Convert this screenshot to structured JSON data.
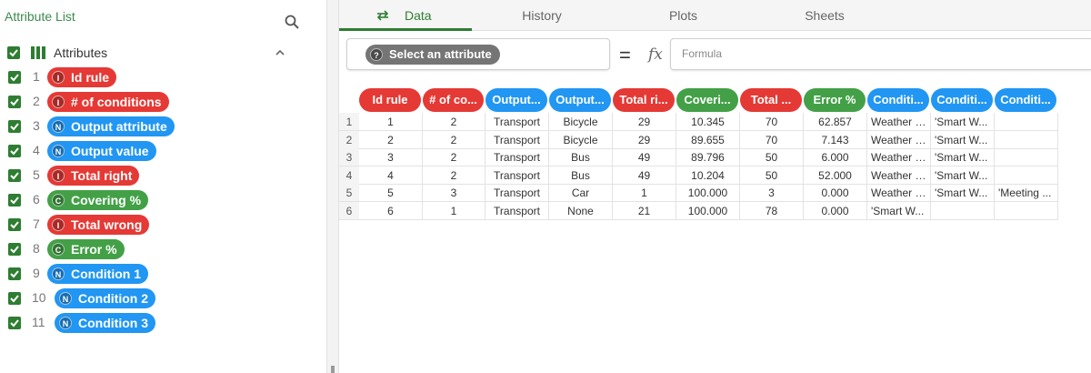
{
  "left_panel": {
    "title": "Attribute List",
    "header_label": "Attributes",
    "attributes": [
      {
        "index": "1",
        "name": "Id rule",
        "type": "I",
        "color": "#e53935"
      },
      {
        "index": "2",
        "name": "# of conditions",
        "type": "I",
        "color": "#e53935"
      },
      {
        "index": "3",
        "name": "Output attribute",
        "type": "N",
        "color": "#2196f3"
      },
      {
        "index": "4",
        "name": "Output value",
        "type": "N",
        "color": "#2196f3"
      },
      {
        "index": "5",
        "name": "Total right",
        "type": "I",
        "color": "#e53935"
      },
      {
        "index": "6",
        "name": "Covering %",
        "type": "C",
        "color": "#43a047"
      },
      {
        "index": "7",
        "name": "Total wrong",
        "type": "I",
        "color": "#e53935"
      },
      {
        "index": "8",
        "name": "Error %",
        "type": "C",
        "color": "#43a047"
      },
      {
        "index": "9",
        "name": "Condition 1",
        "type": "N",
        "color": "#2196f3"
      },
      {
        "index": "10",
        "name": "Condition 2",
        "type": "N",
        "color": "#2196f3"
      },
      {
        "index": "11",
        "name": "Condition 3",
        "type": "N",
        "color": "#2196f3"
      }
    ]
  },
  "tabs": [
    "Data",
    "History",
    "Plots",
    "Sheets"
  ],
  "formula_bar": {
    "select_badge": "?",
    "select_label": "Select an attribute",
    "equals": "=",
    "fx": "fx",
    "formula_placeholder": "Formula"
  },
  "table": {
    "headers": [
      {
        "label": "Id rule",
        "type": "I"
      },
      {
        "label": "# of co...",
        "type": "I"
      },
      {
        "label": "Output...",
        "type": "N"
      },
      {
        "label": "Output...",
        "type": "N"
      },
      {
        "label": "Total ri...",
        "type": "I"
      },
      {
        "label": "Coveri...",
        "type": "C"
      },
      {
        "label": "Total ...",
        "type": "I"
      },
      {
        "label": "Error %",
        "type": "C"
      },
      {
        "label": "Conditi...",
        "type": "N"
      },
      {
        "label": "Conditi...",
        "type": "N"
      },
      {
        "label": "Conditi...",
        "type": "N"
      }
    ],
    "rows": [
      {
        "n": "1",
        "cells": [
          "1",
          "2",
          "Transport",
          "Bicycle",
          "29",
          "10.345",
          "70",
          "62.857",
          "Weather i...",
          "'Smart W...",
          ""
        ]
      },
      {
        "n": "2",
        "cells": [
          "2",
          "2",
          "Transport",
          "Bicycle",
          "29",
          "89.655",
          "70",
          "7.143",
          "Weather i...",
          "'Smart W...",
          ""
        ]
      },
      {
        "n": "3",
        "cells": [
          "3",
          "2",
          "Transport",
          "Bus",
          "49",
          "89.796",
          "50",
          "6.000",
          "Weather i...",
          "'Smart W...",
          ""
        ]
      },
      {
        "n": "4",
        "cells": [
          "4",
          "2",
          "Transport",
          "Bus",
          "49",
          "10.204",
          "50",
          "52.000",
          "Weather i...",
          "'Smart W...",
          ""
        ]
      },
      {
        "n": "5",
        "cells": [
          "5",
          "3",
          "Transport",
          "Car",
          "1",
          "100.000",
          "3",
          "0.000",
          "Weather i...",
          "'Smart W...",
          "'Meeting ..."
        ]
      },
      {
        "n": "6",
        "cells": [
          "6",
          "1",
          "Transport",
          "None",
          "21",
          "100.000",
          "78",
          "0.000",
          "'Smart W...",
          "",
          ""
        ]
      }
    ]
  },
  "colors": {
    "integer": "#e53935",
    "nominal": "#2196f3",
    "continuous": "#43a047",
    "accent": "#2e7d32"
  }
}
